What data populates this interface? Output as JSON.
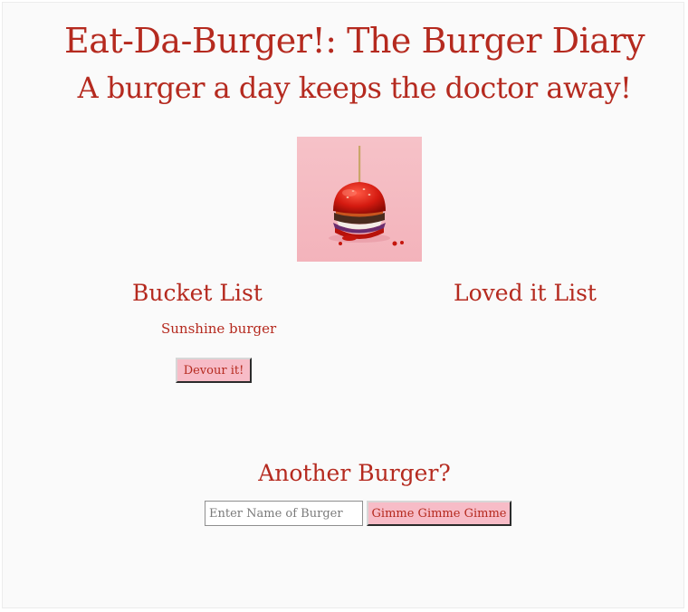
{
  "header": {
    "title": "Eat-Da-Burger!: The Burger Diary",
    "subtitle": "A burger a day keeps the doctor away!"
  },
  "hero": {
    "image_icon": "burger-photo"
  },
  "bucket_list": {
    "heading": "Bucket List",
    "items": [
      {
        "name": "Sunshine burger",
        "button_label": "Devour it!"
      }
    ]
  },
  "loved_list": {
    "heading": "Loved it List",
    "items": []
  },
  "add_burger": {
    "heading": "Another Burger?",
    "input_placeholder": "Enter Name of Burger",
    "input_value": "",
    "submit_label": "Gimme Gimme Gimme"
  },
  "colors": {
    "text": "#b52a1f",
    "button_bg": "#f7bcc7",
    "background": "#fafafa"
  }
}
